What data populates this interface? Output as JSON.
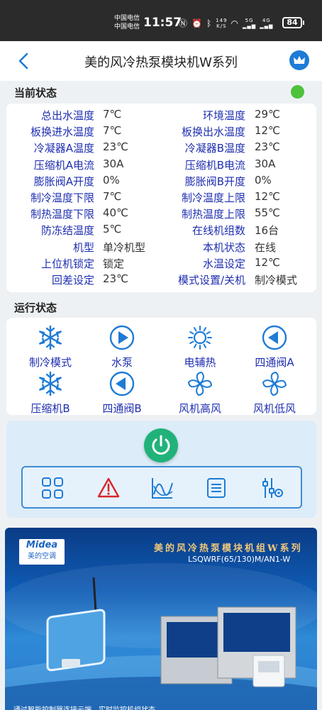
{
  "status_bar": {
    "carrier1": "中国电信",
    "carrier2": "中国电信",
    "time": "11:57",
    "net_speed": "149\nK/S",
    "signal_text": "5G 4G",
    "battery": "84"
  },
  "nav": {
    "title": "美的风冷热泵模块机W系列"
  },
  "current_status": {
    "title": "当前状态",
    "online_color": "#4ec23b",
    "rows": [
      {
        "l1": "总出水温度",
        "v1": "7℃",
        "l2": "环境温度",
        "v2": "29℃"
      },
      {
        "l1": "板换进水温度",
        "v1": "7℃",
        "l2": "板换出水温度",
        "v2": "12℃"
      },
      {
        "l1": "冷凝器A温度",
        "v1": "23℃",
        "l2": "冷凝器B温度",
        "v2": "23℃"
      },
      {
        "l1": "压缩机A电流",
        "v1": "30A",
        "l2": "压缩机B电流",
        "v2": "30A"
      },
      {
        "l1": "膨胀阀A开度",
        "v1": "0%",
        "l2": "膨胀阀B开度",
        "v2": "0%"
      },
      {
        "l1": "制冷温度下限",
        "v1": "7℃",
        "l2": "制冷温度上限",
        "v2": "12℃"
      },
      {
        "l1": "制热温度下限",
        "v1": "40℃",
        "l2": "制热温度上限",
        "v2": "55℃"
      },
      {
        "l1": "防冻结温度",
        "v1": "5℃",
        "l2": "在线机组数",
        "v2": "16台"
      },
      {
        "l1": "机型",
        "v1": "单冷机型",
        "l2": "本机状态",
        "v2": "在线"
      },
      {
        "l1": "上位机锁定",
        "v1": "锁定",
        "l2": "水温设定",
        "v2": "12℃"
      },
      {
        "l1": "回差设定",
        "v1": "23℃",
        "l2": "模式设置/关机",
        "v2": "制冷模式"
      }
    ]
  },
  "run_status": {
    "title": "运行状态",
    "items": [
      {
        "label": "制冷模式",
        "icon": "snowflake-icon"
      },
      {
        "label": "水泵",
        "icon": "play-circle-icon"
      },
      {
        "label": "电辅热",
        "icon": "sun-icon"
      },
      {
        "label": "四通阀A",
        "icon": "play-circle-left-icon"
      },
      {
        "label": "压缩机B",
        "icon": "snowflake-icon"
      },
      {
        "label": "四通阀B",
        "icon": "play-circle-left-icon"
      },
      {
        "label": "风机高风",
        "icon": "fan-icon"
      },
      {
        "label": "风机低风",
        "icon": "fan-icon"
      }
    ]
  },
  "controls": {
    "power": "power-icon",
    "tools": [
      "grid-icon",
      "alarm-icon",
      "curve-icon",
      "list-icon",
      "settings-icon"
    ]
  },
  "banner": {
    "logo_en": "Midea",
    "logo_cn": "美的空调",
    "title": "美的风冷热泵模块机组W系列",
    "model": "LSQWRF(65/130)M/AN1-W",
    "bottom": "通过智能控制器连接云端，实时监控机组状态"
  },
  "colors": {
    "accent": "#1f2fb0",
    "icon_blue": "#1e7bd6",
    "power_green": "#21b27a",
    "alarm_red": "#d9262c"
  }
}
